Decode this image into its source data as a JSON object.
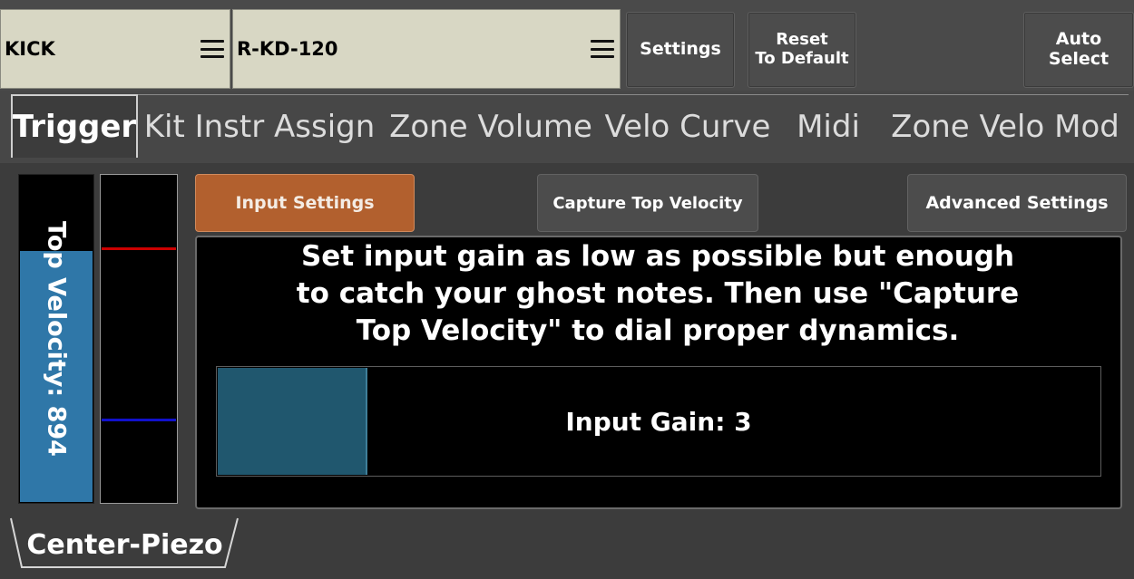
{
  "header": {
    "instrument": {
      "label": "KICK"
    },
    "pad_model": {
      "label": "R-KD-120"
    },
    "buttons": {
      "settings": "Settings",
      "reset_line1": "Reset",
      "reset_line2": "To Default",
      "auto_line1": "Auto",
      "auto_line2": "Select"
    }
  },
  "tabs": [
    {
      "label": "Trigger",
      "active": true
    },
    {
      "label": "Kit Instr Assign"
    },
    {
      "label": "Zone Volume"
    },
    {
      "label": "Velo Curve"
    },
    {
      "label": "Midi"
    },
    {
      "label": "Zone Velo Mod"
    }
  ],
  "velocity": {
    "label": "Top Velocity: 894",
    "fill_fraction": 0.77,
    "color": "#2f77a8"
  },
  "subtabs": {
    "input_settings": "Input Settings",
    "capture": "Capture Top Velocity",
    "advanced": "Advanced Settings"
  },
  "panel": {
    "instruction_line1": "Set input gain as low as possible but enough",
    "instruction_line2": "to catch your ghost notes. Then use \"Capture",
    "instruction_line3": "Top Velocity\" to dial proper dynamics.",
    "gain_label": "Input Gain: 3",
    "gain_fraction": 0.17
  },
  "zone": {
    "label": "Center-Piezo"
  },
  "colors": {
    "accent": "#b2602e",
    "gain_fill": "#20576e",
    "meter_red": "#cc0000",
    "meter_blue": "#1111cc"
  },
  "icons": {
    "menu": "menu-icon"
  }
}
